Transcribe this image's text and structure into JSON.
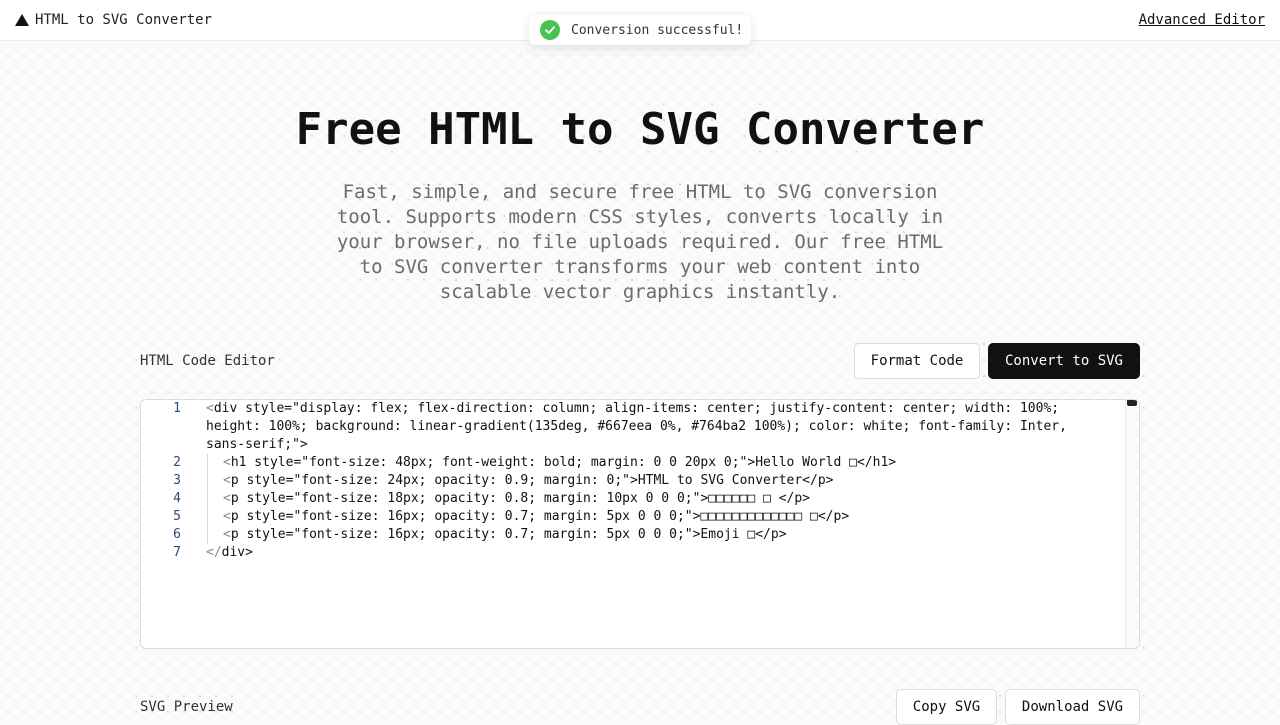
{
  "header": {
    "brand": "HTML to SVG Converter",
    "advanced_link": "Advanced Editor"
  },
  "toast": {
    "message": "Conversion successful!"
  },
  "hero": {
    "title": "Free HTML to SVG Converter",
    "description": "Fast, simple, and secure free HTML to SVG conversion tool. Supports modern CSS styles, converts locally in your browser, no file uploads required. Our free HTML to SVG converter transforms your web content into scalable vector graphics instantly."
  },
  "editor": {
    "label": "HTML Code Editor",
    "format_label": "Format Code",
    "convert_label": "Convert to SVG",
    "lines": [
      {
        "num": "1",
        "pre": "<",
        "text": "div style=\"display: flex; flex-direction: column; align-items: center; justify-content: center; width: 100%; height: 100%; background: linear-gradient(135deg, #667eea 0%, #764ba2 100%); color: white; font-family: Inter, sans-serif;\"",
        "post": ">"
      },
      {
        "num": "2",
        "pre": "<",
        "text": "h1 style=\"font-size: 48px; font-weight: bold; margin: 0 0 20px 0;\"",
        "post": ">Hello World □</h1>"
      },
      {
        "num": "3",
        "pre": "<",
        "text": "p style=\"font-size: 24px; opacity: 0.9; margin: 0;\"",
        "post": ">HTML to SVG Converter</p>"
      },
      {
        "num": "4",
        "pre": "<",
        "text": "p style=\"font-size: 18px; opacity: 0.8; margin: 10px 0 0 0;\"",
        "post": ">□□□□□□ □ </p>"
      },
      {
        "num": "5",
        "pre": "<",
        "text": "p style=\"font-size: 16px; opacity: 0.7; margin: 5px 0 0 0;\"",
        "post": ">□□□□□□□□□□□□□ □</p>"
      },
      {
        "num": "6",
        "pre": "<",
        "text": "p style=\"font-size: 16px; opacity: 0.7; margin: 5px 0 0 0;\"",
        "post": ">Emoji □</p>"
      },
      {
        "num": "7",
        "pre": "</",
        "text": "div",
        "post": ">"
      }
    ]
  },
  "preview": {
    "label": "SVG Preview",
    "copy_label": "Copy SVG",
    "download_label": "Download SVG"
  }
}
